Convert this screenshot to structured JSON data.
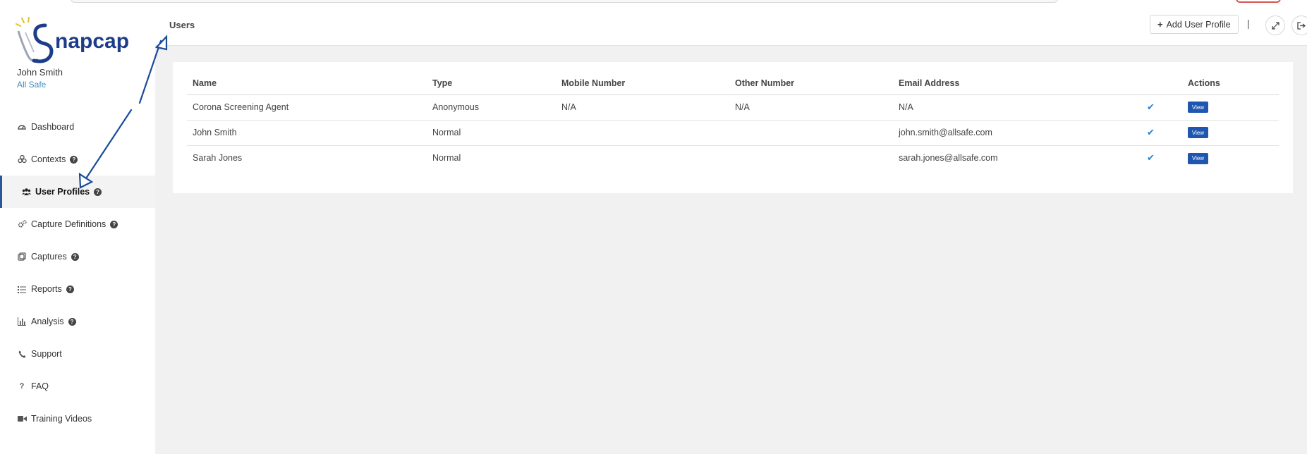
{
  "brand": {
    "logo_text": "napcap"
  },
  "user": {
    "name": "John Smith",
    "org": "All Safe"
  },
  "sidebar": {
    "items": [
      {
        "label": "Dashboard",
        "icon": "dashboard-icon",
        "help": false
      },
      {
        "label": "Contexts",
        "icon": "contexts-icon",
        "help": true
      },
      {
        "label": "User Profiles",
        "icon": "users-icon",
        "help": true,
        "active": true
      },
      {
        "label": "Capture Definitions",
        "icon": "cogs-icon",
        "help": true
      },
      {
        "label": "Captures",
        "icon": "captures-icon",
        "help": true
      },
      {
        "label": "Reports",
        "icon": "list-icon",
        "help": true
      },
      {
        "label": "Analysis",
        "icon": "bar-chart-icon",
        "help": true
      },
      {
        "label": "Support",
        "icon": "phone-icon",
        "help": false
      },
      {
        "label": "FAQ",
        "icon": "question-icon",
        "help": false
      },
      {
        "label": "Training Videos",
        "icon": "video-camera-icon",
        "help": false
      }
    ]
  },
  "header": {
    "title": "Users",
    "add_button_label": "Add User Profile",
    "pipe": "|"
  },
  "table": {
    "columns": [
      "Name",
      "Type",
      "Mobile Number",
      "Other Number",
      "Email Address",
      "",
      "Actions"
    ],
    "rows": [
      {
        "name": "Corona Screening Agent",
        "type": "Anonymous",
        "mobile": "N/A",
        "other": "N/A",
        "email": "N/A",
        "check": "✔",
        "action": "View"
      },
      {
        "name": "John Smith",
        "type": "Normal",
        "mobile": "",
        "other": "",
        "email": "john.smith@allsafe.com",
        "check": "✔",
        "action": "View"
      },
      {
        "name": "Sarah Jones",
        "type": "Normal",
        "mobile": "",
        "other": "",
        "email": "sarah.jones@allsafe.com",
        "check": "✔",
        "action": "View"
      }
    ]
  },
  "colors": {
    "accent": "#1f56b0",
    "link": "#3c8dbc",
    "annotation": "#1a4a9a"
  }
}
